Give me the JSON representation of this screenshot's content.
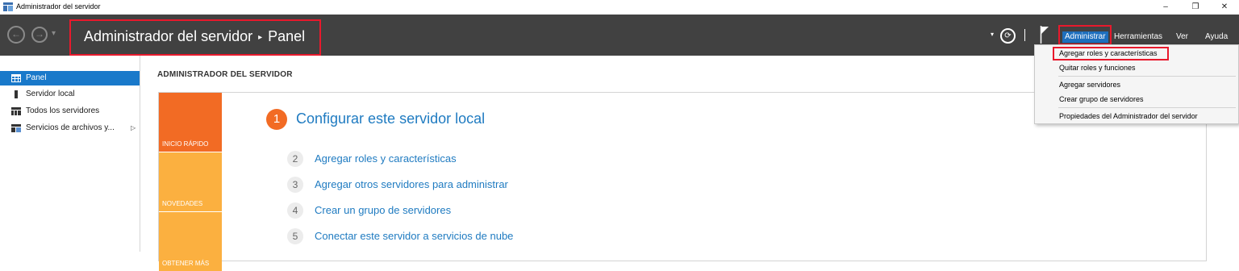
{
  "window": {
    "title": "Administrador del servidor",
    "minimize": "–",
    "restore": "❐",
    "close": "✕"
  },
  "header": {
    "back_icon": "←",
    "forward_icon": "→",
    "dropdown_icon": "▾",
    "breadcrumb_root": "Administrador del servidor",
    "breadcrumb_sep": "▸",
    "breadcrumb_page": "Panel",
    "refresh_icon": "⟳",
    "flag_icon": "flag-icon",
    "menus": [
      "Administrar",
      "Herramientas",
      "Ver",
      "Ayuda"
    ]
  },
  "sidebar": {
    "items": [
      {
        "label": "Panel",
        "icon": "dashboard-icon"
      },
      {
        "label": "Servidor local",
        "icon": "server-icon"
      },
      {
        "label": "Todos los servidores",
        "icon": "servers-icon"
      },
      {
        "label": "Servicios de archivos y...",
        "icon": "file-services-icon"
      }
    ]
  },
  "main": {
    "title": "ADMINISTRADOR DEL SERVIDOR",
    "tiles": [
      "INICIO RÁPIDO",
      "NOVEDADES",
      "OBTENER MÁS"
    ],
    "step1": {
      "num": "1",
      "label": "Configurar este servidor local"
    },
    "steps": [
      {
        "num": "2",
        "label": "Agregar roles y características"
      },
      {
        "num": "3",
        "label": "Agregar otros servidores para administrar"
      },
      {
        "num": "4",
        "label": "Crear un grupo de servidores"
      },
      {
        "num": "5",
        "label": "Conectar este servidor a servicios de nube"
      }
    ]
  },
  "dropdown": {
    "items": [
      "Agregar roles y características",
      "Quitar roles y funciones",
      "Agregar servidores",
      "Crear grupo de servidores",
      "Propiedades del Administrador del servidor"
    ]
  },
  "colors": {
    "header_bg": "#414141",
    "accent_blue": "#1979ca",
    "orange": "#f26b24",
    "amber": "#fbb040",
    "highlight_red": "#e8192c"
  }
}
